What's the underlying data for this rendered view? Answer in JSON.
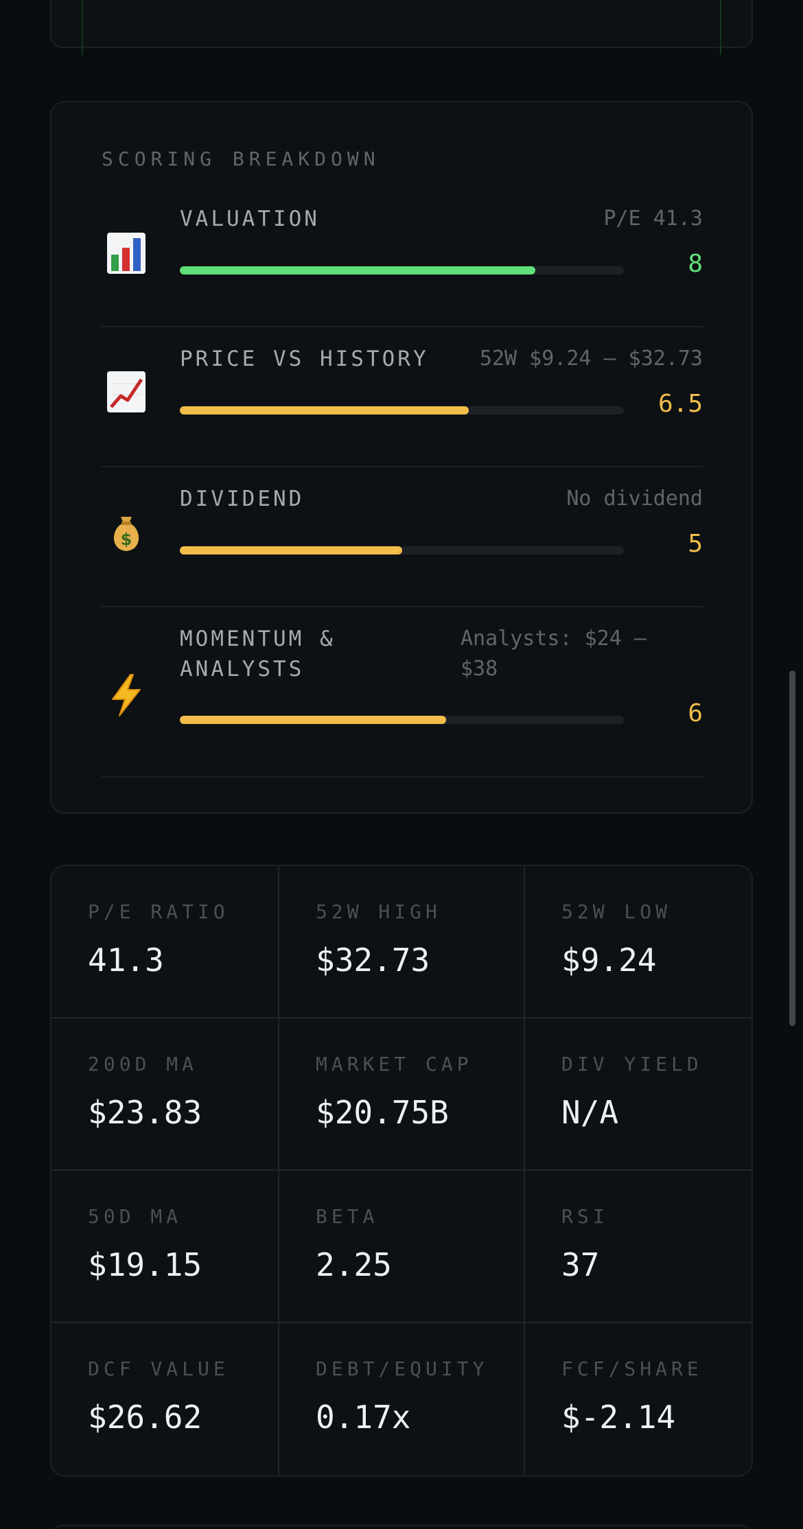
{
  "scoring": {
    "title": "SCORING BREAKDOWN",
    "items": [
      {
        "icon": "bar-chart-icon",
        "label": "VALUATION",
        "detail": "P/E 41.3",
        "score": "8",
        "score_value": 8,
        "max": 10,
        "color": "#5fe07a"
      },
      {
        "icon": "chart-increasing-icon",
        "label": "PRICE VS HISTORY",
        "detail": "52W $9.24 — $32.73",
        "score": "6.5",
        "score_value": 6.5,
        "max": 10,
        "color": "#f2bd4a"
      },
      {
        "icon": "money-bag-icon",
        "label": "DIVIDEND",
        "detail": "No dividend",
        "score": "5",
        "score_value": 5,
        "max": 10,
        "color": "#f2bd4a"
      },
      {
        "icon": "lightning-icon",
        "label": "MOMENTUM & ANALYSTS",
        "label_line1": "MOMENTUM &",
        "label_line2": "ANALYSTS",
        "detail": "Analysts: $24 — $38",
        "detail_line1": "Analysts: $24 —",
        "detail_line2": "$38",
        "score": "6",
        "score_value": 6,
        "max": 10,
        "color": "#f2bd4a"
      }
    ]
  },
  "metrics": [
    {
      "label": "P/E RATIO",
      "value": "41.3"
    },
    {
      "label": "52W HIGH",
      "value": "$32.73"
    },
    {
      "label": "52W LOW",
      "value": "$9.24"
    },
    {
      "label": "200D MA",
      "value": "$23.83"
    },
    {
      "label": "MARKET CAP",
      "value": "$20.75B"
    },
    {
      "label": "DIV YIELD",
      "value": "N/A"
    },
    {
      "label": "50D MA",
      "value": "$19.15"
    },
    {
      "label": "BETA",
      "value": "2.25"
    },
    {
      "label": "RSI",
      "value": "37"
    },
    {
      "label": "DCF VALUE",
      "value": "$26.62"
    },
    {
      "label": "DEBT/EQUITY",
      "value": "0.17x"
    },
    {
      "label": "FCF/SHARE",
      "value": "$-2.14"
    }
  ]
}
